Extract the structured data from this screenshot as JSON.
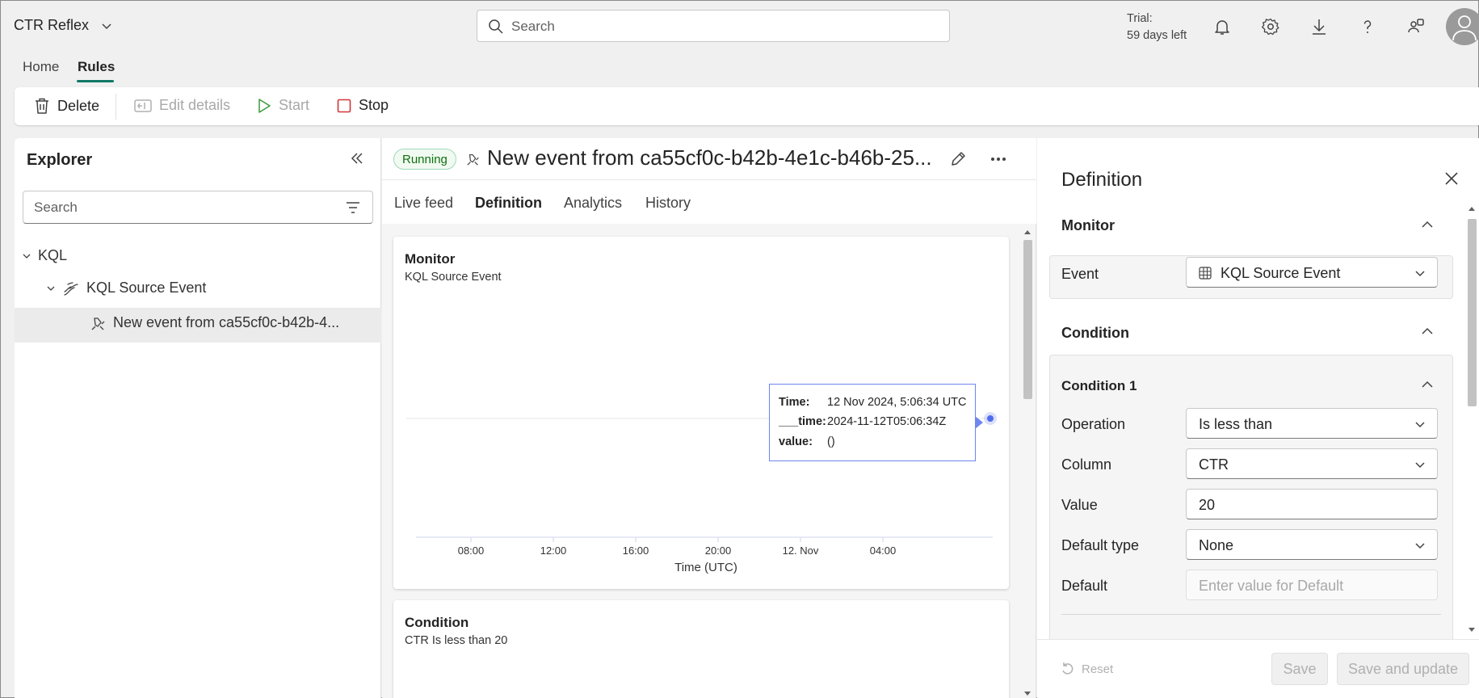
{
  "app": {
    "title": "CTR Reflex"
  },
  "search": {
    "placeholder": "Search"
  },
  "trial": {
    "line1": "Trial:",
    "line2": "59 days left"
  },
  "main_tabs": [
    {
      "label": "Home"
    },
    {
      "label": "Rules"
    }
  ],
  "toolbar": {
    "delete": "Delete",
    "edit_details": "Edit details",
    "start": "Start",
    "stop": "Stop"
  },
  "explorer": {
    "title": "Explorer",
    "search_placeholder": "Search",
    "tree": [
      {
        "label": "KQL"
      },
      {
        "label": "KQL Source Event"
      },
      {
        "label": "New event from ca55cf0c-b42b-4..."
      }
    ]
  },
  "rule": {
    "status": "Running",
    "title": "New event from ca55cf0c-b42b-4e1c-b46b-25..."
  },
  "center_tabs": [
    {
      "label": "Live feed"
    },
    {
      "label": "Definition"
    },
    {
      "label": "Analytics"
    },
    {
      "label": "History"
    }
  ],
  "monitor_card": {
    "title": "Monitor",
    "subtitle": "KQL Source Event",
    "xlabel": "Time (UTC)",
    "tooltip": {
      "time_label": "Time:",
      "time_value": "12 Nov 2024, 5:06:34 UTC",
      "raw_time_label": "___time:",
      "raw_time_value": "2024-11-12T05:06:34Z",
      "value_label": "value:",
      "value_value": "()"
    }
  },
  "chart_data": {
    "type": "scatter",
    "categories": [
      "08:00",
      "12:00",
      "16:00",
      "20:00",
      "12. Nov",
      "04:00"
    ],
    "xlabel": "Time (UTC)",
    "ylabel": "",
    "series": [
      {
        "x": [
          "2024-11-12T05:06:34Z"
        ],
        "y": [
          0
        ]
      }
    ],
    "grid": false
  },
  "condition_card": {
    "title": "Condition",
    "subtitle": "CTR Is less than 20"
  },
  "definition": {
    "title": "Definition",
    "monitor": {
      "header": "Monitor",
      "event_label": "Event",
      "event_value": "KQL Source Event"
    },
    "condition": {
      "header": "Condition",
      "condition1_header": "Condition 1",
      "operation_label": "Operation",
      "operation_value": "Is less than",
      "column_label": "Column",
      "column_value": "CTR",
      "value_label": "Value",
      "value_value": "20",
      "default_type_label": "Default type",
      "default_type_value": "None",
      "default_label": "Default",
      "default_placeholder": "Enter value for Default"
    },
    "footer": {
      "reset": "Reset",
      "save": "Save",
      "save_and_update": "Save and update"
    }
  },
  "colors": {
    "accent": "#117865",
    "running_green": "#0e700e",
    "stop_red": "#d13438",
    "start_green": "#3b9a3b",
    "chart_point": "#4f6bed"
  }
}
